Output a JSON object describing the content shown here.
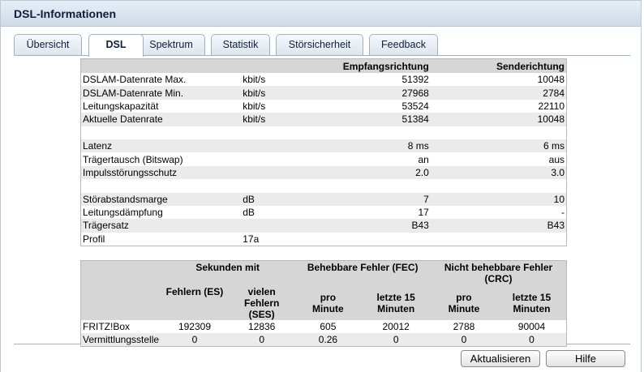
{
  "window": {
    "title": "DSL-Informationen"
  },
  "tabs": [
    {
      "label": "Übersicht",
      "active": false
    },
    {
      "label": "DSL",
      "active": true
    },
    {
      "label": "Spektrum",
      "active": false
    },
    {
      "label": "Statistik",
      "active": false
    },
    {
      "label": "Störsicherheit",
      "active": false
    },
    {
      "label": "Feedback",
      "active": false
    }
  ],
  "info_table": {
    "headers": {
      "downstream": "Empfangsrichtung",
      "upstream": "Senderichtung"
    },
    "rows": [
      {
        "label": "DSLAM-Datenrate Max.",
        "unit": "kbit/s",
        "down": "51392",
        "up": "10048"
      },
      {
        "label": "DSLAM-Datenrate Min.",
        "unit": "kbit/s",
        "down": "27968",
        "up": "2784"
      },
      {
        "label": "Leitungskapazität",
        "unit": "kbit/s",
        "down": "53524",
        "up": "22110"
      },
      {
        "label": "Aktuelle Datenrate",
        "unit": "kbit/s",
        "down": "51384",
        "up": "10048"
      },
      {
        "label": "",
        "unit": "",
        "down": "",
        "up": ""
      },
      {
        "label": "Latenz",
        "unit": "",
        "down": "8 ms",
        "up": "6 ms"
      },
      {
        "label": "Trägertausch (Bitswap)",
        "unit": "",
        "down": "an",
        "up": "aus"
      },
      {
        "label": "Impulsstörungsschutz",
        "unit": "",
        "down": "2.0",
        "up": "3.0"
      },
      {
        "label": "",
        "unit": "",
        "down": "",
        "up": ""
      },
      {
        "label": "Störabstandsmarge",
        "unit": "dB",
        "down": "7",
        "up": "10"
      },
      {
        "label": "Leitungsdämpfung",
        "unit": "dB",
        "down": "17",
        "up": "-"
      },
      {
        "label": "Trägersatz",
        "unit": "",
        "down": "B43",
        "up": "B43"
      },
      {
        "label": "Profil",
        "unit": "17a",
        "down": "",
        "up": ""
      }
    ]
  },
  "error_table": {
    "group_headers": {
      "seconds": "Sekunden mit",
      "fec": "Behebbare Fehler (FEC)",
      "crc": "Nicht behebbare Fehler (CRC)"
    },
    "sub_headers": {
      "es": "Fehlern (ES)",
      "ses": "vielen Fehlern (SES)",
      "fec_per_min": "pro Minute",
      "fec_last15": "letzte 15 Minuten",
      "crc_per_min": "pro Minute",
      "crc_last15": "letzte 15 Minuten"
    },
    "rows": [
      {
        "label": "FRITZ!Box",
        "es": "192309",
        "ses": "12836",
        "fec_per_min": "605",
        "fec_last15": "20012",
        "crc_per_min": "2788",
        "crc_last15": "90004"
      },
      {
        "label": "Vermittlungsstelle",
        "es": "0",
        "ses": "0",
        "fec_per_min": "0.26",
        "fec_last15": "0",
        "crc_per_min": "0",
        "crc_last15": "0"
      }
    ]
  },
  "buttons": {
    "refresh": "Aktualisieren",
    "help": "Hilfe"
  }
}
